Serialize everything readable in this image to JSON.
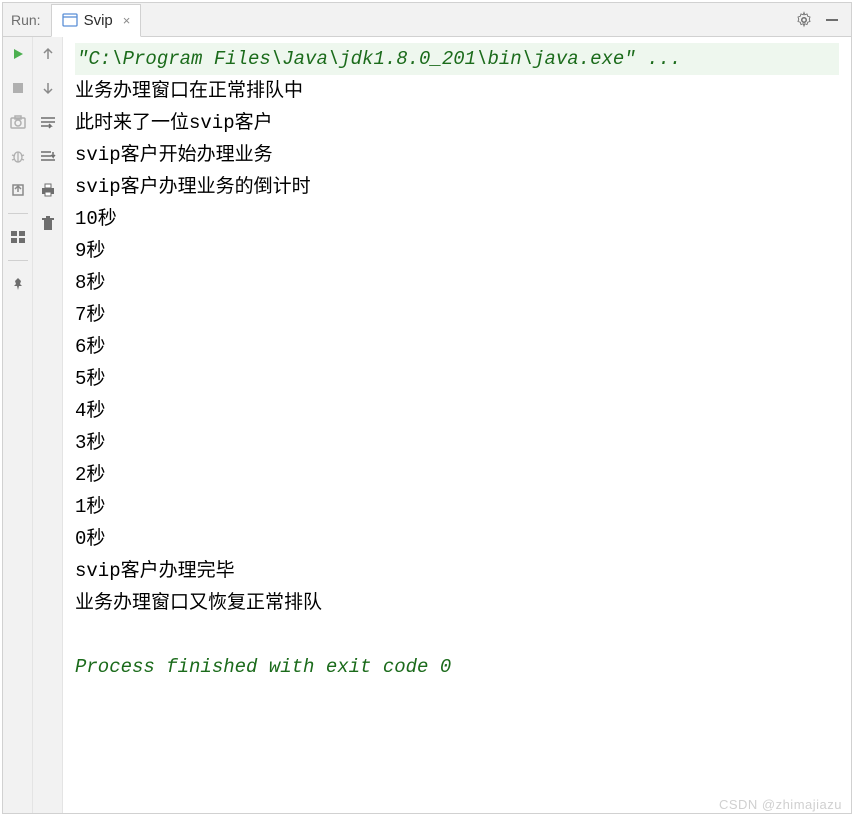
{
  "header": {
    "label": "Run:",
    "tab_label": "Svip",
    "tab_close": "×"
  },
  "console": {
    "command_line": "\"C:\\Program Files\\Java\\jdk1.8.0_201\\bin\\java.exe\" ...",
    "lines": [
      "业务办理窗口在正常排队中",
      "此时来了一位svip客户",
      "svip客户开始办理业务",
      "svip客户办理业务的倒计时",
      "10秒",
      "9秒",
      "8秒",
      "7秒",
      "6秒",
      "5秒",
      "4秒",
      "3秒",
      "2秒",
      "1秒",
      "0秒",
      "svip客户办理完毕",
      "业务办理窗口又恢复正常排队"
    ],
    "exit_line": "Process finished with exit code 0"
  },
  "icons": {
    "settings": "gear-icon",
    "minimize": "minimize-icon",
    "run": "play-icon",
    "stop": "stop-icon",
    "camera": "camera-icon",
    "bug": "bug-icon",
    "export": "export-icon",
    "layout": "layout-icon",
    "pin": "pin-icon",
    "up": "arrow-up-icon",
    "down": "arrow-down-icon",
    "wrap": "soft-wrap-icon",
    "scroll": "scroll-to-end-icon",
    "print": "print-icon",
    "delete": "trash-icon"
  },
  "watermark": "CSDN @zhimajiazu"
}
